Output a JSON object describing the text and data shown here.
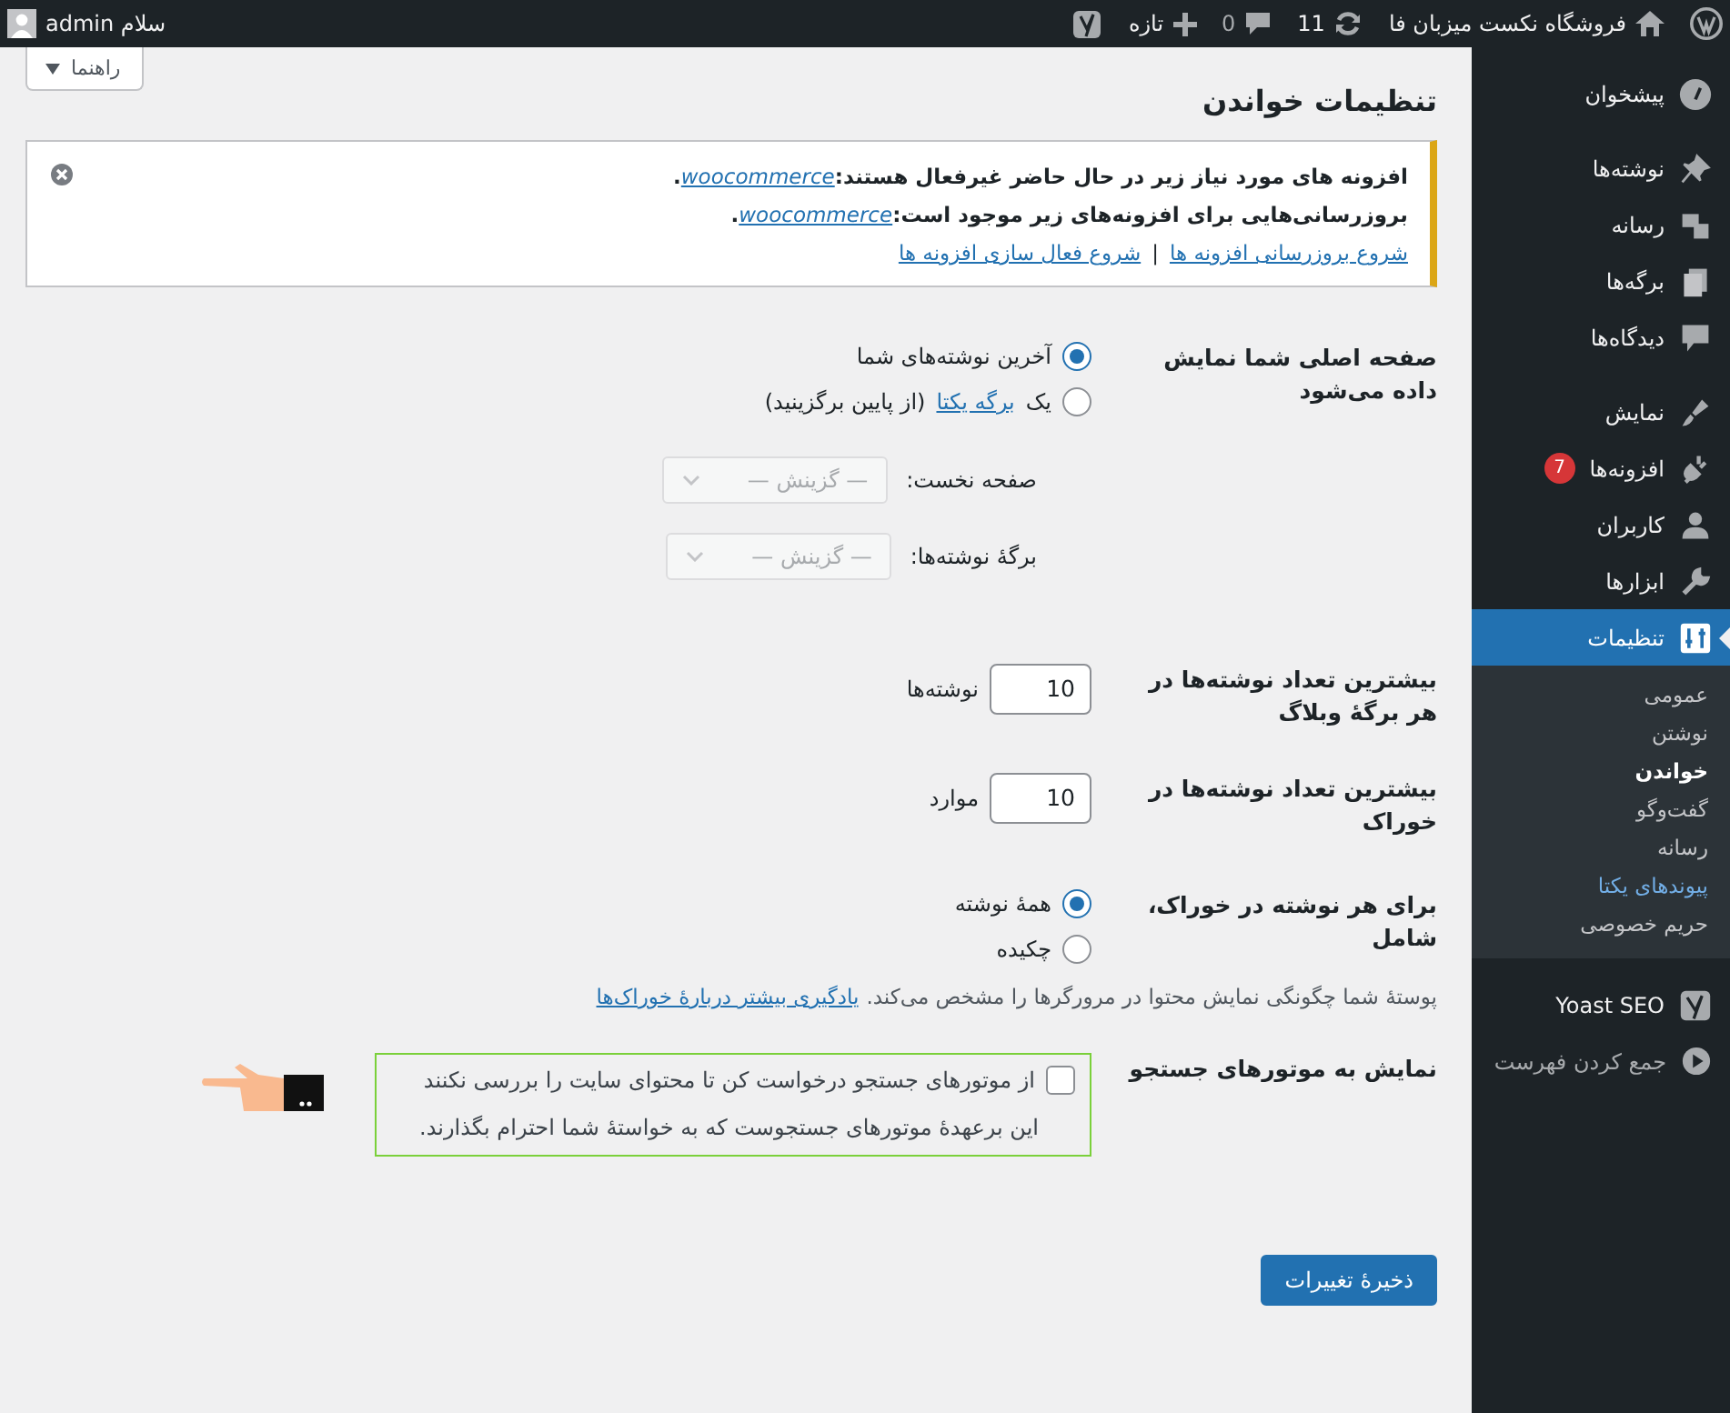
{
  "admin_bar": {
    "site_name": "فروشگاه نکست میزبان فا",
    "updates": "11",
    "comments": "0",
    "new_label": "تازه",
    "greeting": "سلام admin"
  },
  "help_button": {
    "label": "راهنما"
  },
  "page_title": "تنظیمات خواندن",
  "notice": {
    "lines": [
      {
        "text": "افزونه های مورد نیاز زیر در حال حاضر غیرفعال هستند:",
        "link": "woocommerce",
        "end": "."
      },
      {
        "text": "بروزرسانی‌هایی برای افزونه‌های زیر موجود است:",
        "link": "woocommerce",
        "end": "."
      }
    ],
    "actions": [
      "شروع بروزرسانی افزونه ها",
      "شروع فعال سازی افزونه ها"
    ],
    "separator": "|"
  },
  "front_page": {
    "label": "صفحه اصلی شما نمایش داده می‌شود",
    "options": [
      {
        "text": "آخرین نوشته‌های شما",
        "selected": true
      },
      {
        "before": "یک",
        "link": "برگه یکتا",
        "after": "(از پایین برگزینید)",
        "selected": false
      }
    ],
    "selects": [
      {
        "label": "صفحه نخست:",
        "value": "— گزینش —",
        "disabled": true
      },
      {
        "label": "برگهٔ نوشته‌ها:",
        "value": "— گزینش —",
        "disabled": true
      }
    ]
  },
  "posts_per_page": {
    "label": "بیشترین تعداد نوشته‌ها در هر برگهٔ وبلاگ",
    "value": "10",
    "unit": "نوشته‌ها"
  },
  "feed_posts": {
    "label": "بیشترین تعداد نوشته‌ها در خوراک",
    "value": "10",
    "unit": "موارد"
  },
  "feed_content": {
    "label": "برای هر نوشته در خوراک، شامل",
    "options": [
      {
        "text": "همهٔ نوشته",
        "selected": true
      },
      {
        "text": "چکیده",
        "selected": false
      }
    ],
    "description": "پوستهٔ شما چگونگی نمایش محتوا در مرورگرها را مشخص می‌کند.",
    "link": "یادگیری بیشتر دربارهٔ خوراک‌ها"
  },
  "search_visibility": {
    "label": "نمایش به موتورهای جستجو",
    "checkbox": "از موتورهای جستجو درخواست کن تا محتوای سایت را بررسی نکنند",
    "checked": false,
    "note": "این برعهدهٔ موتورهای جستجوست که به خواستهٔ شما احترام بگذارند."
  },
  "save_button": "ذخیرهٔ تغییرات",
  "sidebar": {
    "items": [
      {
        "label": "پیشخوان",
        "selected": false
      },
      {
        "label": "نوشته‌ها",
        "selected": false,
        "group_start": true
      },
      {
        "label": "رسانه",
        "selected": false
      },
      {
        "label": "برگه‌ها",
        "selected": false
      },
      {
        "label": "دیدگاه‌ها",
        "selected": false
      },
      {
        "label": "نمایش",
        "selected": false,
        "group_start": true
      },
      {
        "label": "افزونه‌ها",
        "selected": false,
        "badge": "7"
      },
      {
        "label": "کاربران",
        "selected": false
      },
      {
        "label": "ابزارها",
        "selected": false
      },
      {
        "label": "تنظیمات",
        "selected": true,
        "children": [
          {
            "label": "عمومی",
            "selected": false,
            "highlighted": false
          },
          {
            "label": "نوشتن",
            "selected": false,
            "highlighted": false
          },
          {
            "label": "خواندن",
            "selected": true,
            "highlighted": false
          },
          {
            "label": "گفت‌وگو",
            "selected": false,
            "highlighted": false
          },
          {
            "label": "رسانه",
            "selected": false,
            "highlighted": false
          },
          {
            "label": "پیوندهای یکتا",
            "selected": false,
            "highlighted": true
          },
          {
            "label": "حریم خصوصی",
            "selected": false,
            "highlighted": false
          }
        ]
      },
      {
        "label": "Yoast SEO",
        "selected": false,
        "group_start": true
      }
    ],
    "collapse": "جمع کردن فهرست"
  }
}
